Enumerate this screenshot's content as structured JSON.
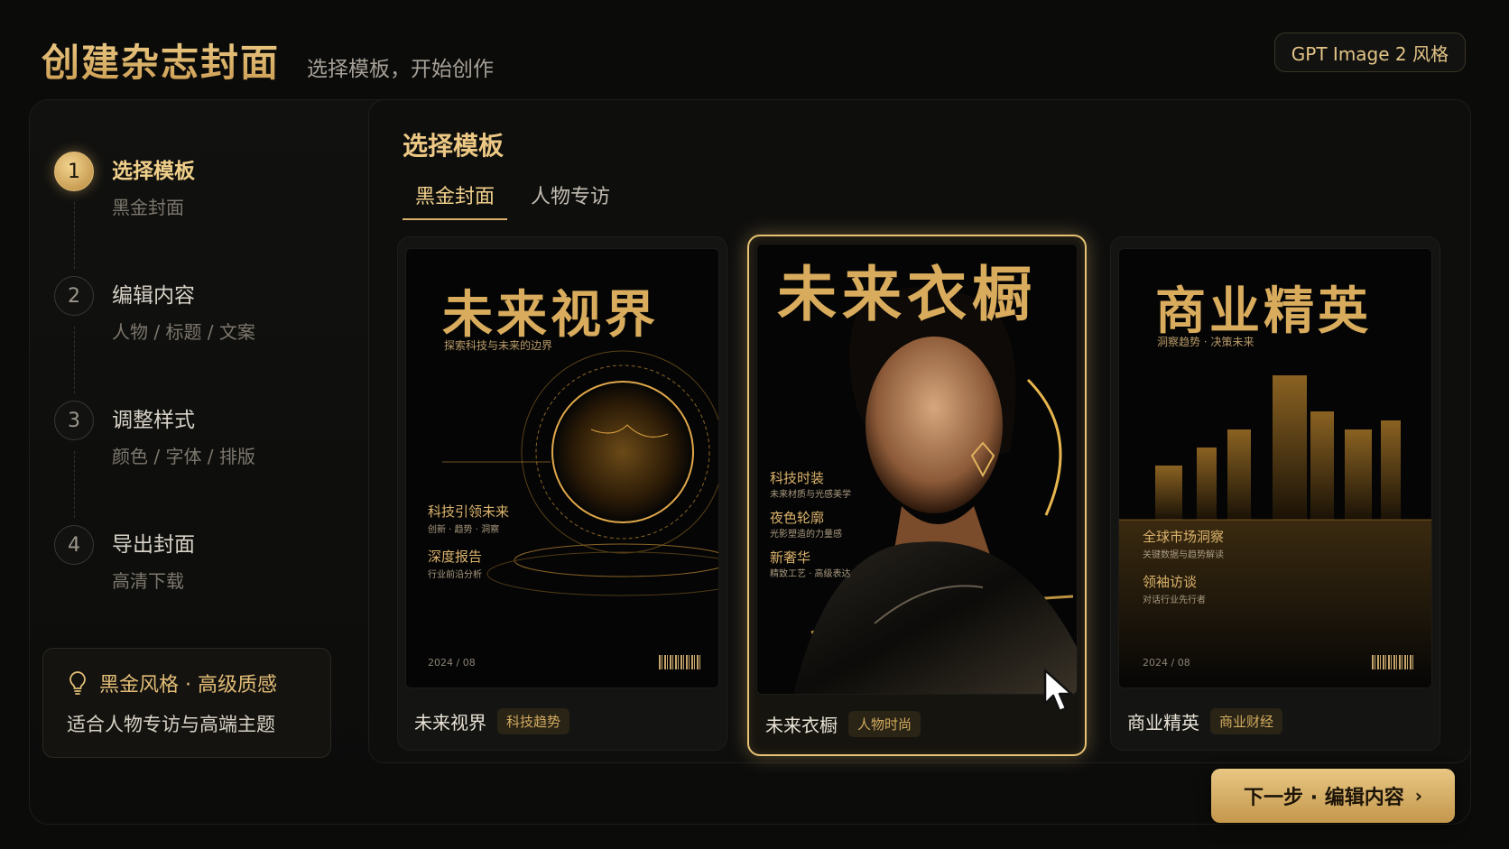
{
  "header": {
    "title": "创建杂志封面",
    "subtitle": "选择模板，开始创作",
    "style_badge": "GPT Image 2 风格"
  },
  "steps": [
    {
      "num": "1",
      "title": "选择模板",
      "sub": "黑金封面",
      "active": true
    },
    {
      "num": "2",
      "title": "编辑内容",
      "sub": "人物 / 标题 / 文案",
      "active": false
    },
    {
      "num": "3",
      "title": "调整样式",
      "sub": "颜色 / 字体 / 排版",
      "active": false
    },
    {
      "num": "4",
      "title": "导出封面",
      "sub": "高清下载",
      "active": false
    }
  ],
  "tip": {
    "icon": "lightbulb-icon",
    "title": "黑金风格 · 高级质感",
    "body": "适合人物专访与高端主题"
  },
  "main": {
    "section_title": "选择模板",
    "tabs": [
      {
        "label": "黑金封面",
        "active": true
      },
      {
        "label": "人物专访",
        "active": false
      }
    ],
    "templates": [
      {
        "name": "未来视界",
        "tag": "科技趋势",
        "selected": false,
        "cover": {
          "title": "未来视界",
          "subtitle": "探索科技与未来的边界",
          "items": [
            {
              "h": "科技引领未来",
              "s": "创新 · 趋势 · 洞察"
            },
            {
              "h": "深度报告",
              "s": "行业前沿分析"
            }
          ],
          "date": "2024 / 08",
          "art": "glowing-globe-illustration"
        }
      },
      {
        "name": "未来衣橱",
        "tag": "人物时尚",
        "selected": true,
        "cover": {
          "title": "未来衣橱",
          "items": [
            {
              "h": "科技时装",
              "s": "未来材质与光感美学"
            },
            {
              "h": "夜色轮廓",
              "s": "光影塑造的力量感"
            },
            {
              "h": "新奢华",
              "s": "精致工艺 · 高级表达"
            }
          ],
          "art": "fashion-portrait-photo"
        }
      },
      {
        "name": "商业精英",
        "tag": "商业财经",
        "selected": false,
        "cover": {
          "title": "商业精英",
          "subtitle": "洞察趋势 · 决策未来",
          "items": [
            {
              "h": "全球市场洞察",
              "s": "关键数据与趋势解读"
            },
            {
              "h": "领袖访谈",
              "s": "对话行业先行者"
            }
          ],
          "date": "2024 / 08",
          "art": "night-city-skyline"
        }
      }
    ]
  },
  "next_button": {
    "label": "下一步 · 编辑内容",
    "icon": "chevron-right-icon"
  },
  "colors": {
    "accent": "#d9b26a",
    "background": "#0b0b0a",
    "button": "#e8c783"
  }
}
